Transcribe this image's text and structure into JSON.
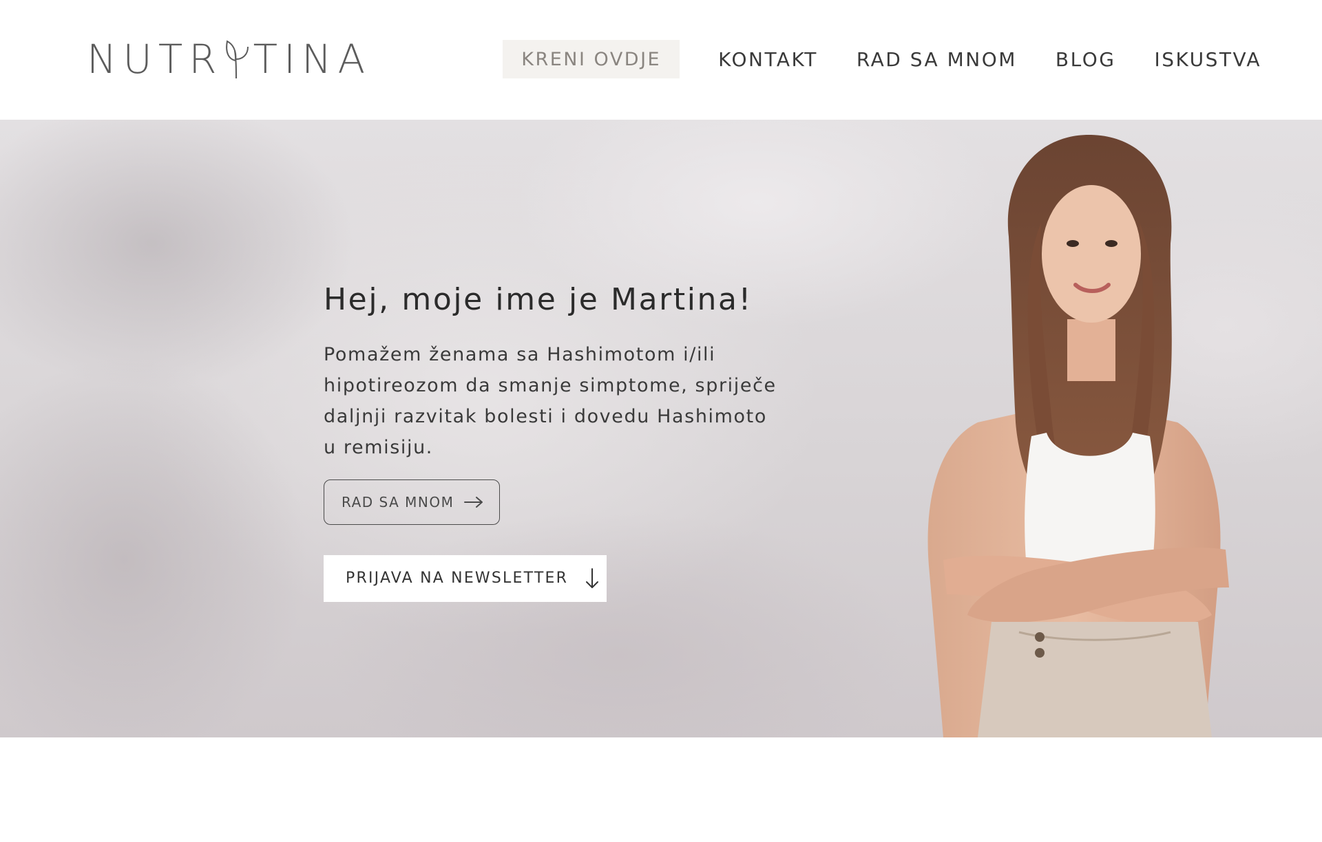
{
  "header": {
    "logo_left": "NUTR",
    "logo_right": "TINA",
    "nav": {
      "cta_label": "KRENI OVDJE",
      "items": [
        {
          "label": "KONTAKT"
        },
        {
          "label": "RAD SA MNOM"
        },
        {
          "label": "BLOG"
        },
        {
          "label": "ISKUSTVA"
        }
      ]
    }
  },
  "hero": {
    "title": "Hej, moje ime je Martina!",
    "description": "Pomažem ženama sa Hashimotom i/ili hipotireozom da smanje simptome, spriječe daljnji razvitak bolesti i dovedu Hashimoto u remisiju.",
    "primary_button_label": "RAD SA MNOM",
    "primary_button_icon": "arrow-right-icon",
    "secondary_button_label": "PRIJAVA NA NEWSLETTER",
    "secondary_button_icon": "arrow-down-icon"
  },
  "colors": {
    "cta_background": "#f4f2ef",
    "cta_text": "#8a8580",
    "text": "#333333",
    "hero_background": "#d9d5d7"
  }
}
